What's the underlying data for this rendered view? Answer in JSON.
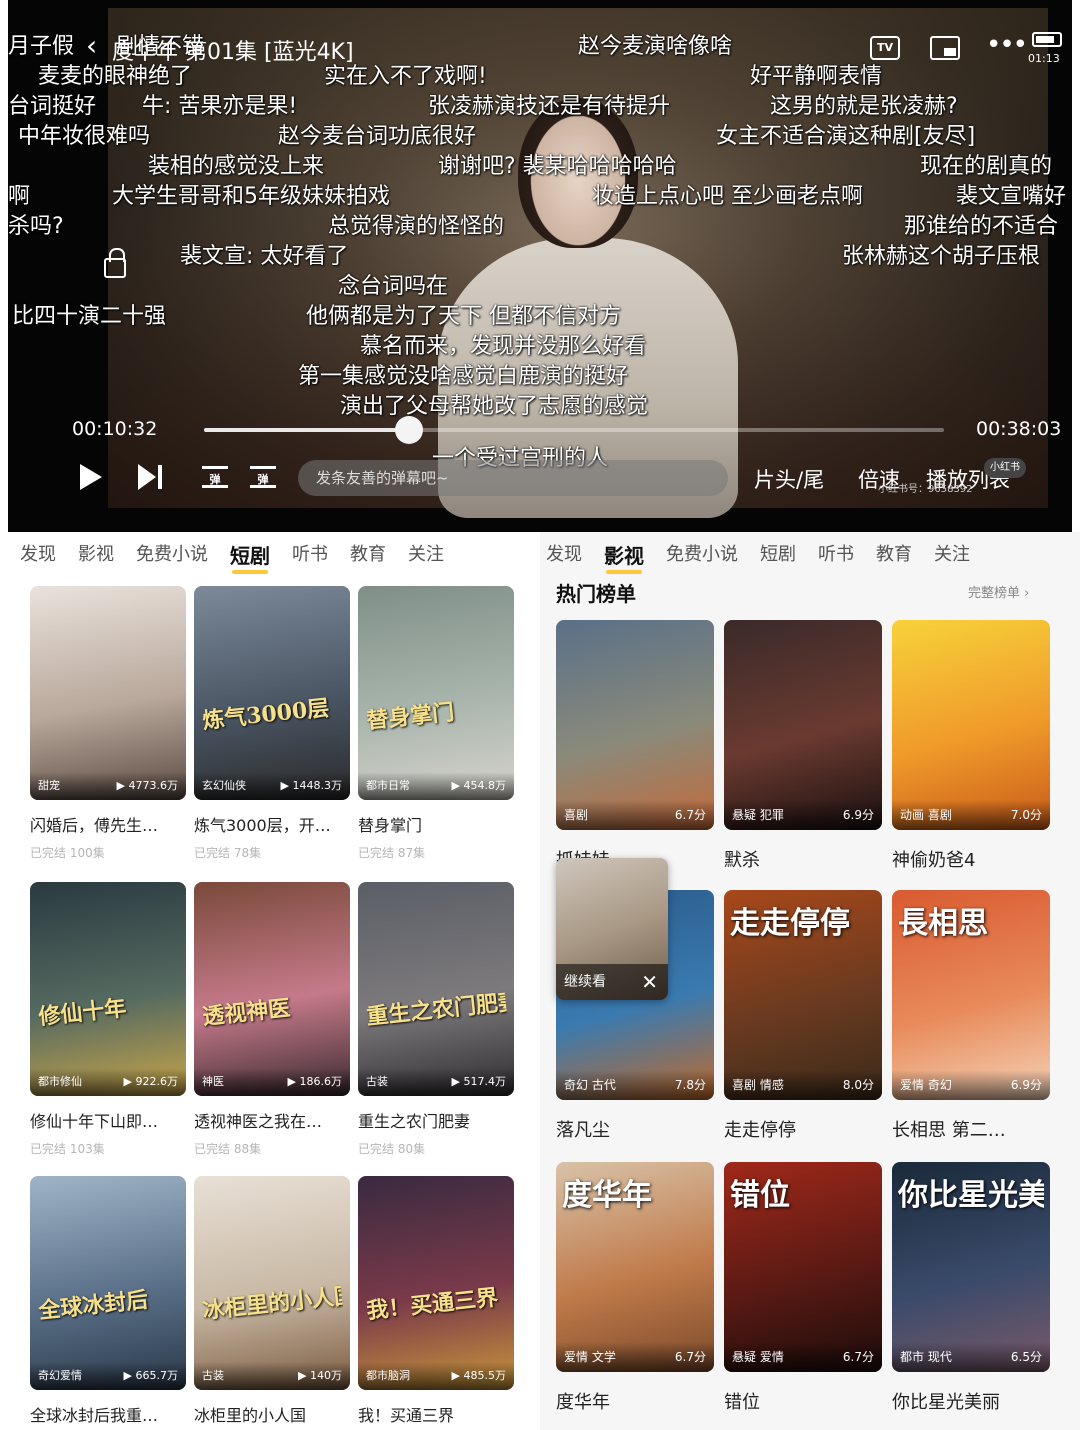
{
  "player": {
    "title": "度华年 第01集 [蓝光4K]",
    "tv_label": "TV",
    "clock": "01:13",
    "current_time": "00:10:32",
    "total_time": "00:38:03",
    "progress": 0.277,
    "danmaku_toggle_a": "弹",
    "danmaku_toggle_b": "弹",
    "danmaku_placeholder": "发条友善的弹幕吧~",
    "ctrl_head_tail": "片头/尾",
    "ctrl_speed": "倍速",
    "ctrl_playlist": "播放列表",
    "watermark": "小红书号：9658392",
    "watermark_badge": "小红书",
    "danmaku": [
      "月子假",
      "剧情不错",
      "赵今麦演啥像啥",
      "麦麦的眼神绝了",
      "实在入不了戏啊!",
      "好平静啊表情",
      "台词挺好",
      "牛: 苦果亦是果!",
      "张凌赫演技还是有待提升",
      "这男的就是张凌赫?",
      "中年妆很难吗",
      "赵今麦台词功底很好",
      "女主不适合演这种剧[友尽]",
      "装相的感觉没上来",
      "谢谢吧? 裴某哈哈哈哈哈",
      "现在的剧真的",
      "啊",
      "大学生哥哥和5年级妹妹拍戏",
      "妆造上点心吧 至少画老点啊",
      "裴文宣嘴好",
      "杀吗?",
      "总觉得演的怪怪的",
      "那谁给的不适合",
      "裴文宣: 太好看了",
      "张林赫这个胡子压根",
      "念台词吗在",
      "比四十演二十强",
      "他俩都是为了天下 但都不信对方",
      "慕名而来，发现并没那么好看",
      "第一集感觉没啥感觉白鹿演的挺好",
      "演出了父母帮她改了志愿的感觉",
      "一个受过宫刑的人"
    ]
  },
  "left": {
    "tabs": [
      "发现",
      "影视",
      "免费小说",
      "短剧",
      "听书",
      "教育",
      "关注"
    ],
    "active_tab": "短剧",
    "cards": [
      {
        "title": "闪婚后，傅先生…",
        "tag": "甜宠",
        "views": "▶ 4773.6万",
        "sub": "已完结  100集",
        "poster_text": "",
        "colors": [
          "#e9e2dc",
          "#b9a89b",
          "#5a4a42"
        ]
      },
      {
        "title": "炼气3000层，开…",
        "tag": "玄幻仙侠",
        "views": "▶ 1448.3万",
        "sub": "已完结  78集",
        "poster_text": "炼气3000层",
        "colors": [
          "#7c8a9a",
          "#4a5664",
          "#2b2a2a"
        ]
      },
      {
        "title": "替身掌门",
        "tag": "都市日常",
        "views": "▶ 454.8万",
        "sub": "已完结  87集",
        "poster_text": "替身掌门",
        "colors": [
          "#7f8f88",
          "#a9b5ac",
          "#d7d4cd"
        ]
      },
      {
        "title": "修仙十年下山即…",
        "tag": "都市修仙",
        "views": "▶ 922.6万",
        "sub": "已完结  103集",
        "poster_text": "修仙十年",
        "colors": [
          "#2a3a40",
          "#556a60",
          "#c9a54a"
        ]
      },
      {
        "title": "透视神医之我在…",
        "tag": "神医",
        "views": "▶ 186.6万",
        "sub": "已完结  88集",
        "poster_text": "透视神医",
        "colors": [
          "#7a4a3a",
          "#c57a8a",
          "#3a2a30"
        ]
      },
      {
        "title": "重生之农门肥妻",
        "tag": "古装",
        "views": "▶ 517.4万",
        "sub": "已完结  80集",
        "poster_text": "重生之农门肥妻",
        "colors": [
          "#5a5e66",
          "#7d7a7c",
          "#2e2c30"
        ]
      },
      {
        "title": "全球冰封后我重…",
        "tag": "奇幻爱情",
        "views": "▶ 665.7万",
        "sub": "",
        "poster_text": "全球冰封后",
        "colors": [
          "#9fb4c8",
          "#5a7088",
          "#2a3848"
        ]
      },
      {
        "title": "冰柜里的小人国",
        "tag": "古装",
        "views": "▶ 140万",
        "sub": "",
        "poster_text": "冰柜里的小人国",
        "colors": [
          "#e8e0d6",
          "#c8b8a4",
          "#7a5a40"
        ]
      },
      {
        "title": "我！买通三界",
        "tag": "都市脑洞",
        "views": "▶ 485.5万",
        "sub": "",
        "poster_text": "我！买通三界",
        "colors": [
          "#3a2a40",
          "#7a3a4a",
          "#c9983a"
        ]
      }
    ]
  },
  "right": {
    "tabs": [
      "发现",
      "影视",
      "免费小说",
      "短剧",
      "听书",
      "教育",
      "关注"
    ],
    "active_tab": "影视",
    "rank_title": "热门榜单",
    "rank_more": "完整榜单 ›",
    "continue_label": "继续看",
    "cards": [
      {
        "title": "抓娃娃",
        "tag": "喜剧",
        "score": "6.7分",
        "poster_text": "",
        "colors": [
          "#5a7088",
          "#8a8a7a",
          "#c46a3a"
        ]
      },
      {
        "title": "默杀",
        "tag": "悬疑 犯罪",
        "score": "6.9分",
        "poster_text": "",
        "colors": [
          "#3a2a2a",
          "#6a3a30",
          "#1a1010"
        ]
      },
      {
        "title": "神偷奶爸4",
        "tag": "动画 喜剧",
        "score": "7.0分",
        "poster_text": "",
        "colors": [
          "#f7d23a",
          "#f09a2a",
          "#c85a1a"
        ]
      },
      {
        "title": "落凡尘",
        "tag": "奇幻 古代",
        "score": "7.8分",
        "poster_text": "",
        "colors": [
          "#2a5a8a",
          "#3a7ab0",
          "#c06a2a"
        ]
      },
      {
        "title": "走走停停",
        "tag": "喜剧 情感",
        "score": "8.0分",
        "poster_text": "走走停停",
        "colors": [
          "#a8481a",
          "#6a3a20",
          "#3a2a1a"
        ]
      },
      {
        "title": "长相思 第二…",
        "tag": "爱情 奇幻",
        "score": "6.9分",
        "poster_text": "長相思",
        "colors": [
          "#d95a30",
          "#e88a5a",
          "#f4d4b8"
        ]
      },
      {
        "title": "度华年",
        "tag": "爱情 文学",
        "score": "6.7分",
        "poster_text": "度华年",
        "colors": [
          "#d8c2a8",
          "#c07a4a",
          "#7a4a2a"
        ]
      },
      {
        "title": "错位",
        "tag": "悬疑 爱情",
        "score": "6.7分",
        "poster_text": "错位",
        "colors": [
          "#a0281a",
          "#5a1a14",
          "#1a0c0a"
        ]
      },
      {
        "title": "你比星光美丽",
        "tag": "都市 现代",
        "score": "6.5分",
        "poster_text": "你比星光美丽",
        "colors": [
          "#1a2a3a",
          "#3a4a6a",
          "#7a5a6a"
        ]
      }
    ]
  }
}
